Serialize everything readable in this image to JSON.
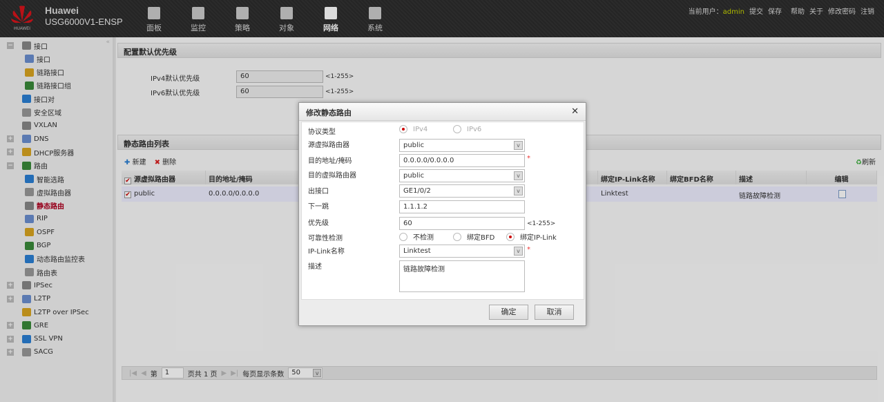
{
  "header": {
    "brand_name": "Huawei",
    "brand_logo_text": "HUAWEI",
    "device": "USG6000V1-ENSP",
    "nav": [
      {
        "label": "面板",
        "icon": "dashboard-icon"
      },
      {
        "label": "监控",
        "icon": "monitor-icon"
      },
      {
        "label": "策略",
        "icon": "policy-icon"
      },
      {
        "label": "对象",
        "icon": "object-icon"
      },
      {
        "label": "网络",
        "icon": "network-icon"
      },
      {
        "label": "系统",
        "icon": "system-icon"
      }
    ],
    "user_label": "当前用户：",
    "user": "admin",
    "links": [
      "提交",
      "保存",
      "帮助",
      "关于",
      "修改密码",
      "注销"
    ]
  },
  "sidebar": {
    "items": [
      {
        "label": "接口",
        "level": 0,
        "toggle": "−"
      },
      {
        "label": "接口",
        "level": 1
      },
      {
        "label": "链路接口",
        "level": 1
      },
      {
        "label": "链路接口组",
        "level": 1
      },
      {
        "label": "接口对",
        "level": 0
      },
      {
        "label": "安全区域",
        "level": 0
      },
      {
        "label": "VXLAN",
        "level": 0
      },
      {
        "label": "DNS",
        "level": 0,
        "toggle": "+"
      },
      {
        "label": "DHCP服务器",
        "level": 0,
        "toggle": "+"
      },
      {
        "label": "路由",
        "level": 0,
        "toggle": "−"
      },
      {
        "label": "智能选路",
        "level": 1
      },
      {
        "label": "虚拟路由器",
        "level": 1
      },
      {
        "label": "静态路由",
        "level": 1,
        "selected": true
      },
      {
        "label": "RIP",
        "level": 1
      },
      {
        "label": "OSPF",
        "level": 1
      },
      {
        "label": "BGP",
        "level": 1
      },
      {
        "label": "动态路由监控表",
        "level": 1
      },
      {
        "label": "路由表",
        "level": 1
      },
      {
        "label": "IPSec",
        "level": 0,
        "toggle": "+"
      },
      {
        "label": "L2TP",
        "level": 0,
        "toggle": "+"
      },
      {
        "label": "L2TP over IPSec",
        "level": 0
      },
      {
        "label": "GRE",
        "level": 0,
        "toggle": "+"
      },
      {
        "label": "SSL VPN",
        "level": 0,
        "toggle": "+"
      },
      {
        "label": "SACG",
        "level": 0,
        "toggle": "+"
      }
    ]
  },
  "default_priority": {
    "title": "配置默认优先级",
    "ipv4_label": "IPv4默认优先级",
    "ipv4_value": "60",
    "ipv6_label": "IPv6默认优先级",
    "ipv6_value": "60",
    "range": "<1-255>"
  },
  "route_list": {
    "title": "静态路由列表",
    "new_label": "新建",
    "delete_label": "删除",
    "refresh_label": "刷新",
    "columns": [
      "源虚拟路由器",
      "目的地址/掩码",
      "绑定IP-Link名称",
      "绑定BFD名称",
      "描述",
      "编辑"
    ],
    "rows": [
      {
        "src_vr": "public",
        "dest": "0.0.0.0/0.0.0.0",
        "ip_link": "Linktest",
        "bfd": "",
        "desc": "链路故障检测"
      }
    ]
  },
  "pager": {
    "page_prefix": "第",
    "page": "1",
    "page_suffix": "页共 1 页",
    "per_page_label": "每页显示条数",
    "per_page": "50"
  },
  "dialog": {
    "title": "修改静态路由",
    "protocol_label": "协议类型",
    "ipv4": "IPv4",
    "ipv6": "IPv6",
    "src_vr_label": "源虚拟路由器",
    "src_vr": "public",
    "dest_label": "目的地址/掩码",
    "dest": "0.0.0.0/0.0.0.0",
    "dst_vr_label": "目的虚拟路由器",
    "dst_vr": "public",
    "out_if_label": "出接口",
    "out_if": "GE1/0/2",
    "next_hop_label": "下一跳",
    "next_hop": "1.1.1.2",
    "priority_label": "优先级",
    "priority": "60",
    "priority_range": "<1-255>",
    "reliability_label": "可靠性检测",
    "rel_none": "不检测",
    "rel_bfd": "绑定BFD",
    "rel_iplink": "绑定IP-Link",
    "iplink_label": "IP-Link名称",
    "iplink": "Linktest",
    "desc_label": "描述",
    "desc": "链路故障检测",
    "ok": "确定",
    "cancel": "取消",
    "required": "*"
  },
  "colors": {
    "accent": "#b00020",
    "user": "#c8d400"
  }
}
